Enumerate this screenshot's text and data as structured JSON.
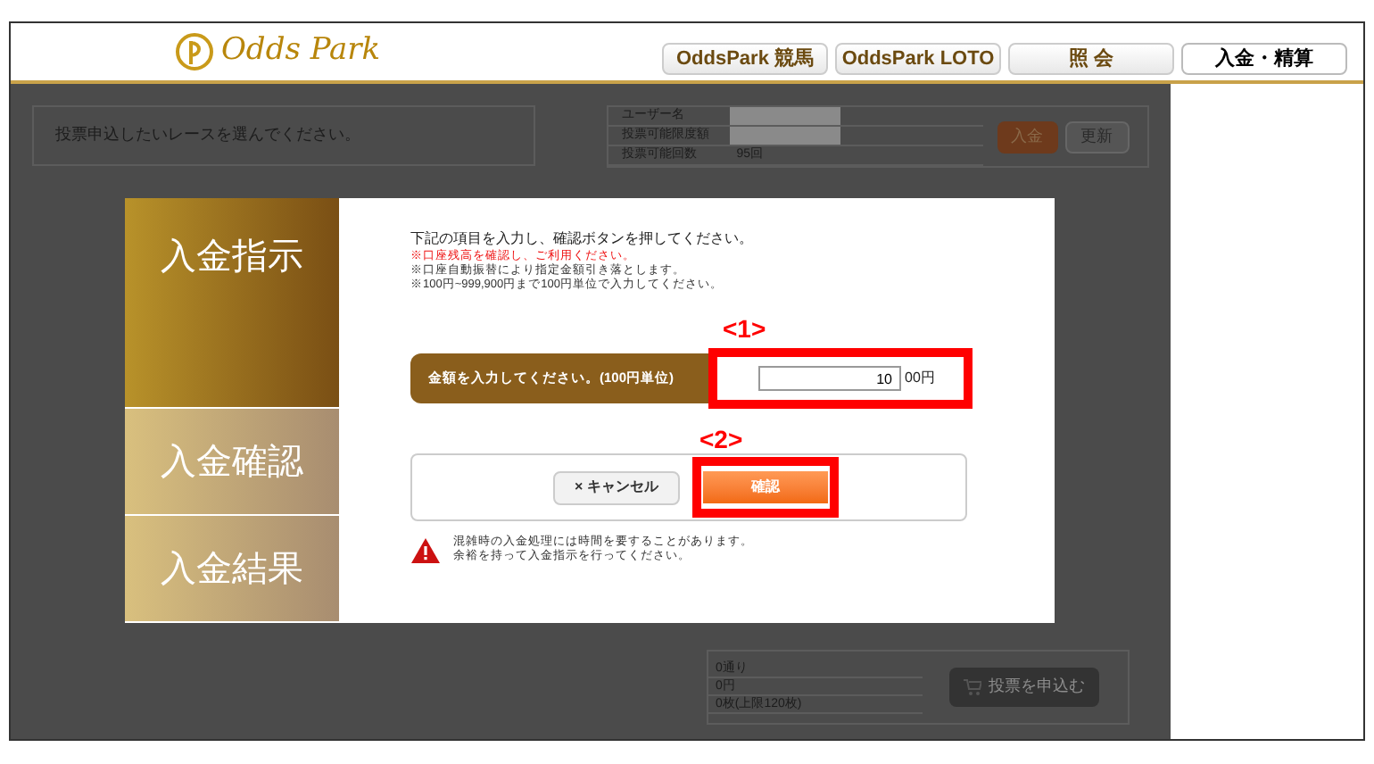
{
  "header": {
    "logo": "Odds Park",
    "tabs": [
      {
        "label": "OddsPark 競馬",
        "selected": false
      },
      {
        "label": "OddsPark LOTO",
        "selected": false
      },
      {
        "label": "照 会",
        "selected": false
      },
      {
        "label": "入金・精算",
        "selected": true
      }
    ]
  },
  "page": {
    "instruction": "投票申込したいレースを選んでください。",
    "account": [
      {
        "label": "ユーザー名"
      },
      {
        "label": "投票可能限度額"
      },
      {
        "label": "投票可能回数",
        "value": "95回"
      }
    ],
    "deposit_button": "入金",
    "refresh_button": "更新",
    "summary": [
      "0通り",
      "0円",
      "0枚(上限120枚)"
    ],
    "submit_button": "投票を申込む"
  },
  "dialog": {
    "steps": [
      {
        "label": "入金指示",
        "selected": true
      },
      {
        "label": "入金確認",
        "selected": false
      },
      {
        "label": "入金結果",
        "selected": false
      }
    ],
    "intro": "下記の項目を入力し、確認ボタンを押してください。",
    "notes": [
      {
        "text": "※口座残高を確認し、ご利用ください。",
        "kind": "alert"
      },
      {
        "text": "※口座自動振替により指定金額引き落とします。",
        "kind": "normal"
      },
      {
        "text": "※100円~999,900円まで100円単位で入力してください。",
        "kind": "normal"
      }
    ],
    "amount_label": "金額を入力してください。(100円単位)",
    "amount_value": "10",
    "amount_suffix": "00円",
    "cancel_button": "× キャンセル",
    "confirm_button": "確認",
    "warning": [
      "混雑時の入金処理には時間を要することがあります。",
      "余裕を持って入金指示を行ってください。"
    ]
  },
  "annotations": [
    "<1>",
    "<2>"
  ]
}
